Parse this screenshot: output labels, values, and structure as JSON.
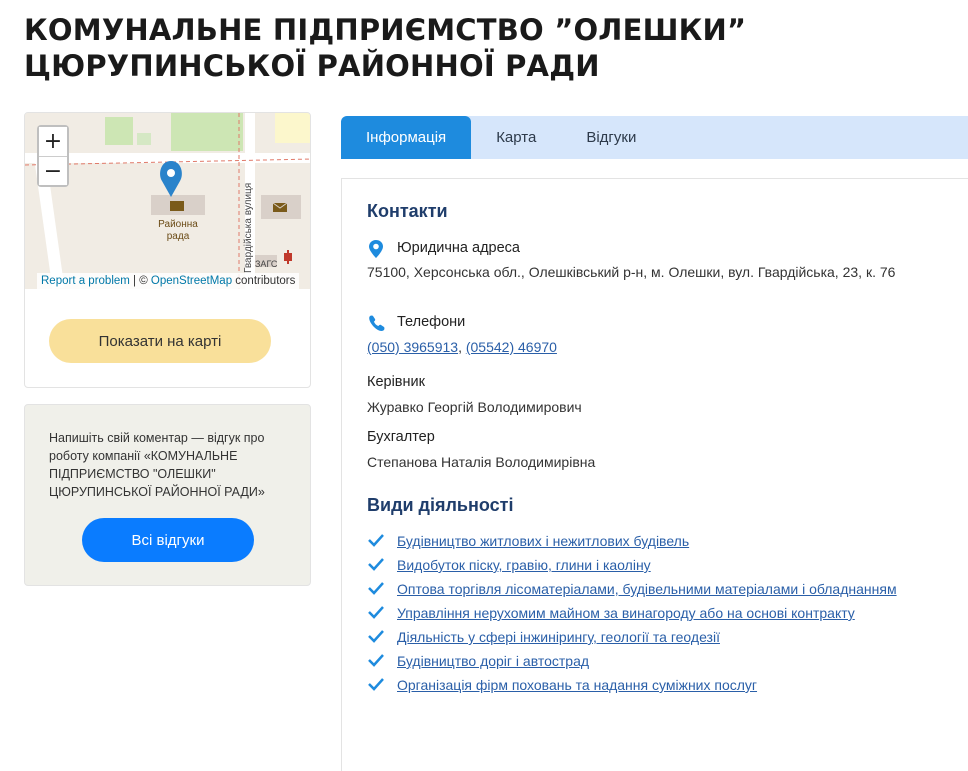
{
  "company": {
    "title": "КОМУНАЛЬНЕ ПІДПРИЄМСТВО ”ОЛЕШКИ” ЦЮРУПИНСЬКОЇ РАЙОННОЇ РАДИ"
  },
  "map": {
    "zoom_in": "+",
    "zoom_out": "−",
    "place_label_line1": "Районна",
    "place_label_line2": "рада",
    "street_label": "Гвардійська вулиця",
    "zags_label": "ЗАГС",
    "attribution_report": "Report a problem",
    "attribution_sep": " | © ",
    "attribution_osm": "OpenStreetMap",
    "attribution_contrib": " contributors",
    "show_on_map_label": "Показати на карті"
  },
  "reviews": {
    "prompt": "Напишіть свій коментар — відгук про роботу компанії «КОМУНАЛЬНЕ ПІДПРИЄМСТВО \"ОЛЕШКИ\" ЦЮРУПИНСЬКОЇ РАЙОННОЇ РАДИ»",
    "all_reviews_label": "Всі відгуки"
  },
  "tabs": [
    {
      "label": "Інформація",
      "active": true
    },
    {
      "label": "Карта",
      "active": false
    },
    {
      "label": "Відгуки",
      "active": false
    }
  ],
  "contacts": {
    "heading": "Контакти",
    "address_label": "Юридична адреса",
    "address_value": "75100, Херсонська обл., Олешківський р-н, м. Олешки, вул. Гвардійська, 23, к. 76",
    "phones_label": "Телефони",
    "phone1": "(050) 3965913",
    "phone_sep": ", ",
    "phone2": "(05542) 46970",
    "director_label": "Керівник",
    "director_value": "Журавко Георгій Володимирович",
    "accountant_label": "Бухгалтер",
    "accountant_value": "Степанова Наталія Володимирівна"
  },
  "activities": {
    "heading": "Види діяльності",
    "items": [
      "Будівництво житлових і нежитлових будівель",
      "Видобуток піску, гравію, глини і каоліну",
      "Оптова торгівля лісоматеріалами, будівельними матеріалами і обладнанням",
      "Управління нерухомим майном за винагороду або на основі контракту",
      "Діяльність у сфері інжинірингу, геології та геодезії",
      "Будівництво доріг і автострад",
      "Організація фірм поховань та надання суміжних послуг"
    ]
  },
  "colors": {
    "accent": "#1e8bde",
    "heading": "#1f3d6b",
    "link": "#2a5fa8",
    "primary_button": "#0a7cff",
    "secondary_button": "#f9e09a"
  }
}
